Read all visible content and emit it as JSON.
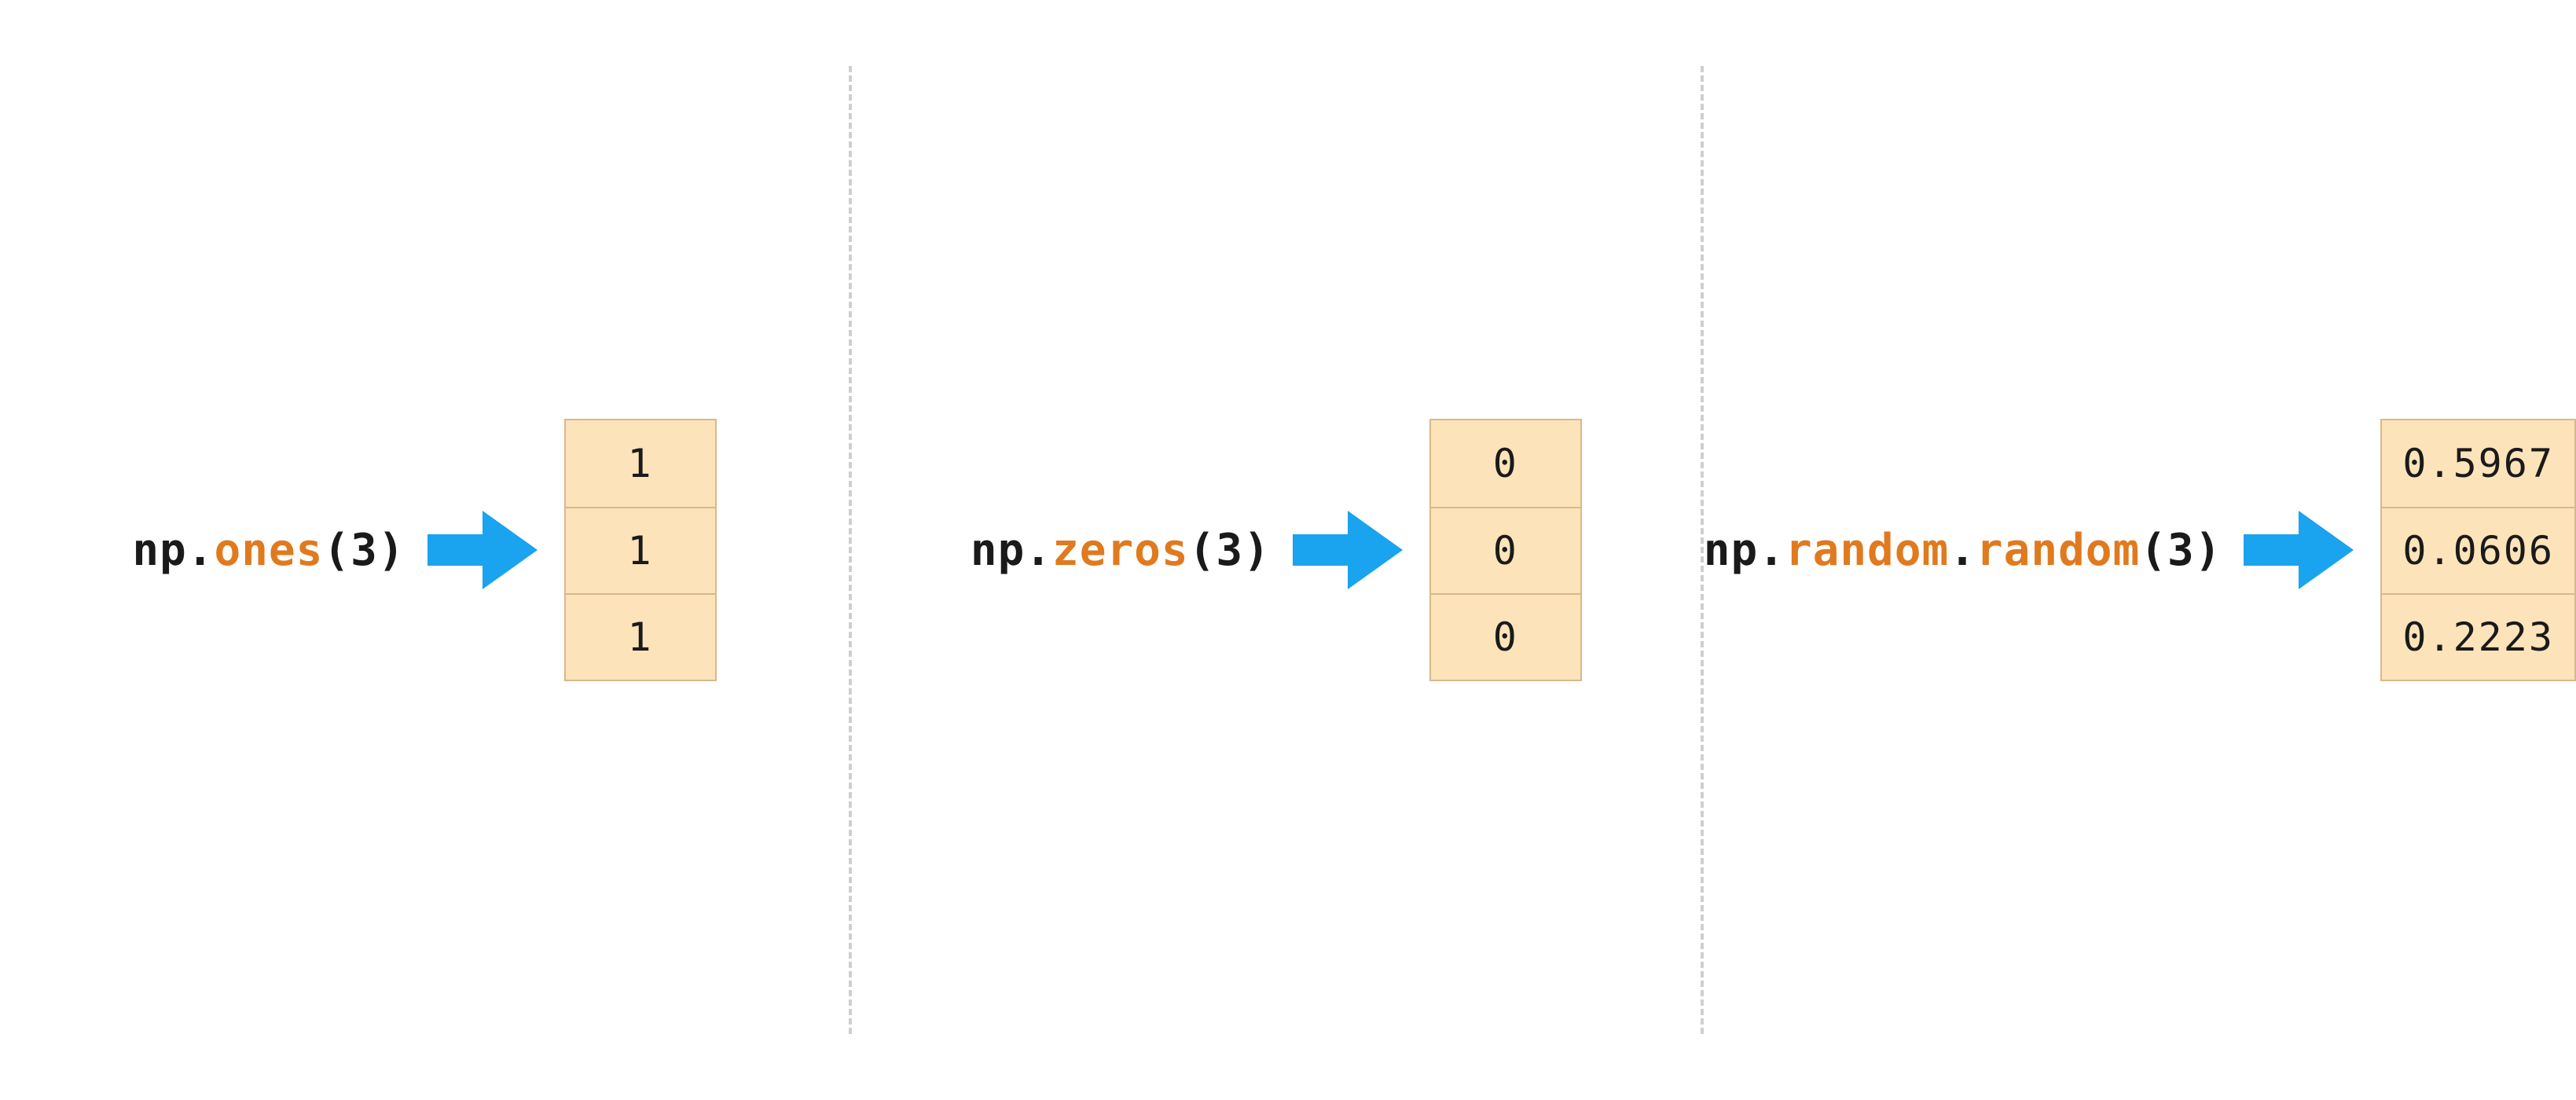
{
  "panels": [
    {
      "code": {
        "np": "np",
        "dot1": ".",
        "func": "ones",
        "lp": "(",
        "arg": "3",
        "rp": ")"
      },
      "values": [
        "1",
        "1",
        "1"
      ]
    },
    {
      "code": {
        "np": "np",
        "dot1": ".",
        "func": "zeros",
        "lp": "(",
        "arg": "3",
        "rp": ")"
      },
      "values": [
        "0",
        "0",
        "0"
      ]
    },
    {
      "code": {
        "np": "np",
        "dot1": ".",
        "mod": "random",
        "dot2": ".",
        "func": "random",
        "lp": "(",
        "arg": "3",
        "rp": ")"
      },
      "values": [
        "0.5967",
        "0.0606",
        "0.2223"
      ]
    }
  ],
  "colors": {
    "arrow": "#1aa3ee",
    "cell_bg": "#fde3ba",
    "cell_border": "#d7b98a",
    "func": "#e07a1f"
  }
}
